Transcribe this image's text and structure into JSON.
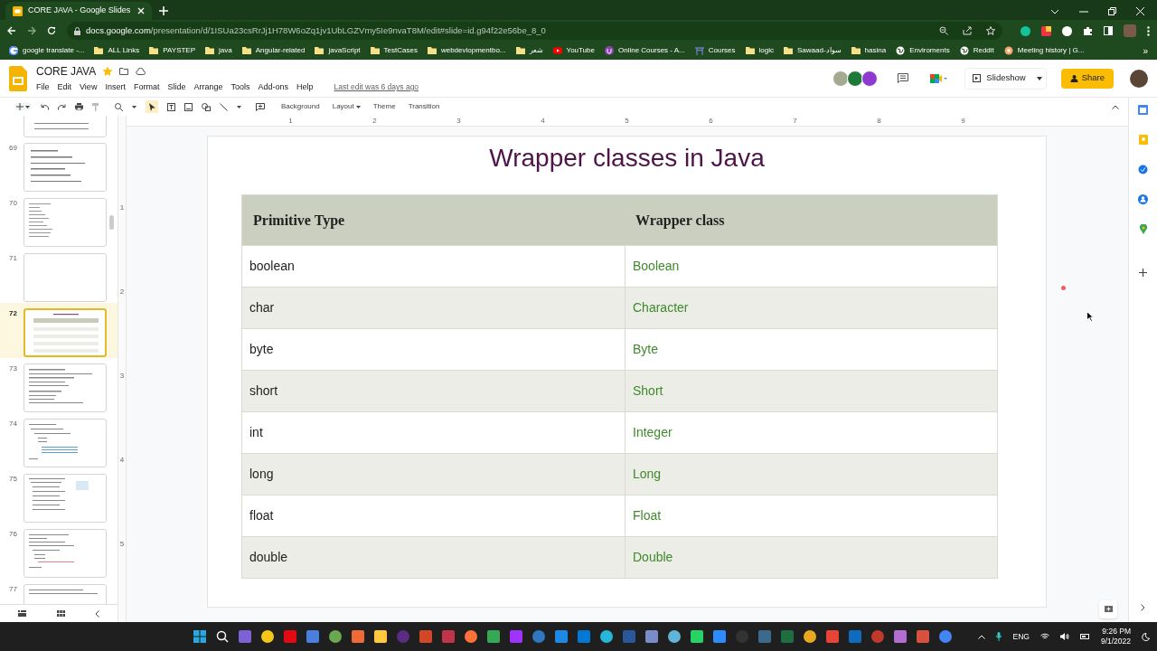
{
  "browser": {
    "tab_title": "CORE JAVA - Google Slides",
    "url_host": "docs.google.com",
    "url_path": "/presentation/d/1ISUa23csRrJj1H78W6oZq1jv1UbLGZVmy5Ie9nvaT8M/edit#slide=id.g94f22e56be_8_0",
    "bookmarks": [
      {
        "label": "google translate -...",
        "kind": "google"
      },
      {
        "label": "ALL Links",
        "kind": "folder"
      },
      {
        "label": "PAYSTEP",
        "kind": "folder"
      },
      {
        "label": "java",
        "kind": "folder"
      },
      {
        "label": "Angular-related",
        "kind": "folder"
      },
      {
        "label": "javaScript",
        "kind": "folder"
      },
      {
        "label": "TestCases",
        "kind": "folder"
      },
      {
        "label": "webdevlopmentbo...",
        "kind": "folder"
      },
      {
        "label": "شعر",
        "kind": "folder"
      },
      {
        "label": "YouTube",
        "kind": "youtube"
      },
      {
        "label": "Online Courses - A...",
        "kind": "course"
      },
      {
        "label": "Courses",
        "kind": "gate"
      },
      {
        "label": "logic",
        "kind": "folder"
      },
      {
        "label": "Sawaad-سواد",
        "kind": "folder"
      },
      {
        "label": "hasina",
        "kind": "folder"
      },
      {
        "label": "Enviroments",
        "kind": "globe"
      },
      {
        "label": "Reddit",
        "kind": "globe"
      },
      {
        "label": "Meeting history | G...",
        "kind": "flower"
      }
    ],
    "overflow": "»"
  },
  "doc": {
    "title": "CORE JAVA",
    "starred": true,
    "menus": [
      "File",
      "Edit",
      "View",
      "Insert",
      "Format",
      "Slide",
      "Arrange",
      "Tools",
      "Add-ons",
      "Help"
    ],
    "last_edit": "Last edit was 6 days ago",
    "toolbar": [
      "Background",
      "Layout",
      "Theme",
      "Transition"
    ],
    "slideshow": "Slideshow",
    "share": "Share"
  },
  "ruler": {
    "horizontal": [
      "1",
      "2",
      "3",
      "4",
      "5",
      "6",
      "7",
      "8",
      "9"
    ],
    "vertical": [
      "1",
      "2",
      "3",
      "4",
      "5"
    ]
  },
  "slides_panel": [
    {
      "number": "69",
      "selected": false
    },
    {
      "number": "70",
      "selected": false
    },
    {
      "number": "71",
      "selected": false
    },
    {
      "number": "72",
      "selected": true
    },
    {
      "number": "73",
      "selected": false
    },
    {
      "number": "74",
      "selected": false
    },
    {
      "number": "75",
      "selected": false
    },
    {
      "number": "76",
      "selected": false
    },
    {
      "number": "77",
      "selected": false
    }
  ],
  "slide": {
    "title": "Wrapper classes in Java",
    "table": {
      "columns": [
        "Primitive Type",
        "Wrapper class"
      ],
      "rows": [
        [
          "boolean",
          "Boolean"
        ],
        [
          "char",
          "Character"
        ],
        [
          "byte",
          "Byte"
        ],
        [
          "short",
          "Short"
        ],
        [
          "int",
          "Integer"
        ],
        [
          "long",
          "Long"
        ],
        [
          "float",
          "Float"
        ],
        [
          "double",
          "Double"
        ]
      ]
    }
  },
  "taskbar": {
    "language": "ENG",
    "time": "9:26 PM",
    "date": "9/1/2022"
  }
}
